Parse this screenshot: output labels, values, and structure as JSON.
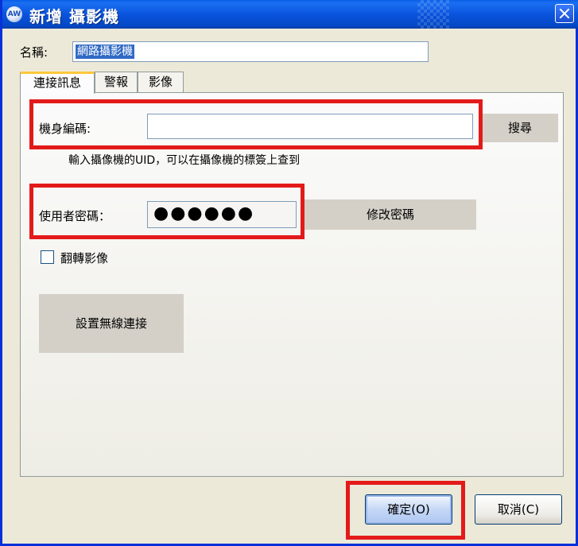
{
  "window": {
    "title": "新增 攝影機",
    "logo_text": "AW",
    "close_icon": "close-icon"
  },
  "name_field": {
    "label": "名稱:",
    "value": "網路攝影機"
  },
  "tabs": [
    {
      "label": "連接訊息",
      "active": true
    },
    {
      "label": "警報",
      "active": false
    },
    {
      "label": "影像",
      "active": false
    }
  ],
  "connection": {
    "serial_label": "機身編碼:",
    "serial_value": "",
    "search_button": "搜尋",
    "hint": "輸入攝像機的UID，可以在攝像機的標簽上查到",
    "password_label": "使用者密碼：",
    "password_mask": "●●●●●●",
    "change_password_button": "修改密碼",
    "flip_label": "翻轉影像",
    "flip_checked": false,
    "wifi_button": "設置無線連接"
  },
  "footer": {
    "ok_button": "確定(O)",
    "cancel_button": "取消(C)"
  },
  "colors": {
    "title_bar": "#0a53dd",
    "highlight": "#e31a1a",
    "selection": "#316ac5"
  }
}
